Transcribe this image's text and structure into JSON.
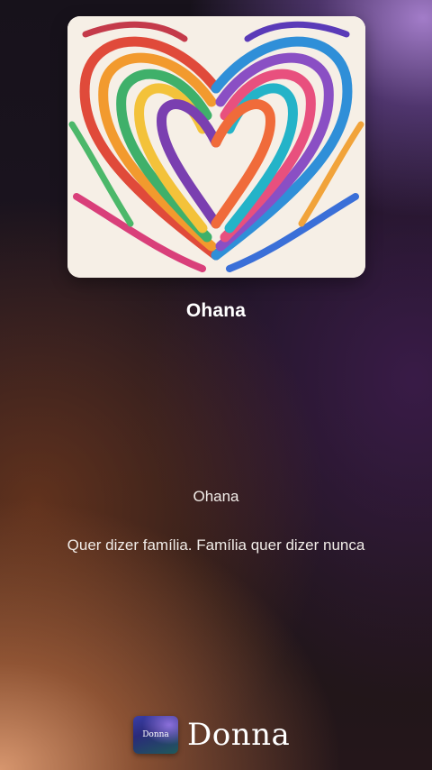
{
  "player": {
    "song_title": "Ohana",
    "cover_alt": "rainbow ribbon heart artwork"
  },
  "lyrics": {
    "line_1": "Ohana",
    "line_2": "Quer dizer família. Família quer dizer nunca"
  },
  "brand": {
    "logo_text": "Donna",
    "name": "Donna"
  },
  "colors": {
    "accent_purple": "#a884d2",
    "accent_orange": "#d7966e",
    "background": "#1a1420",
    "text": "#ffffff"
  }
}
